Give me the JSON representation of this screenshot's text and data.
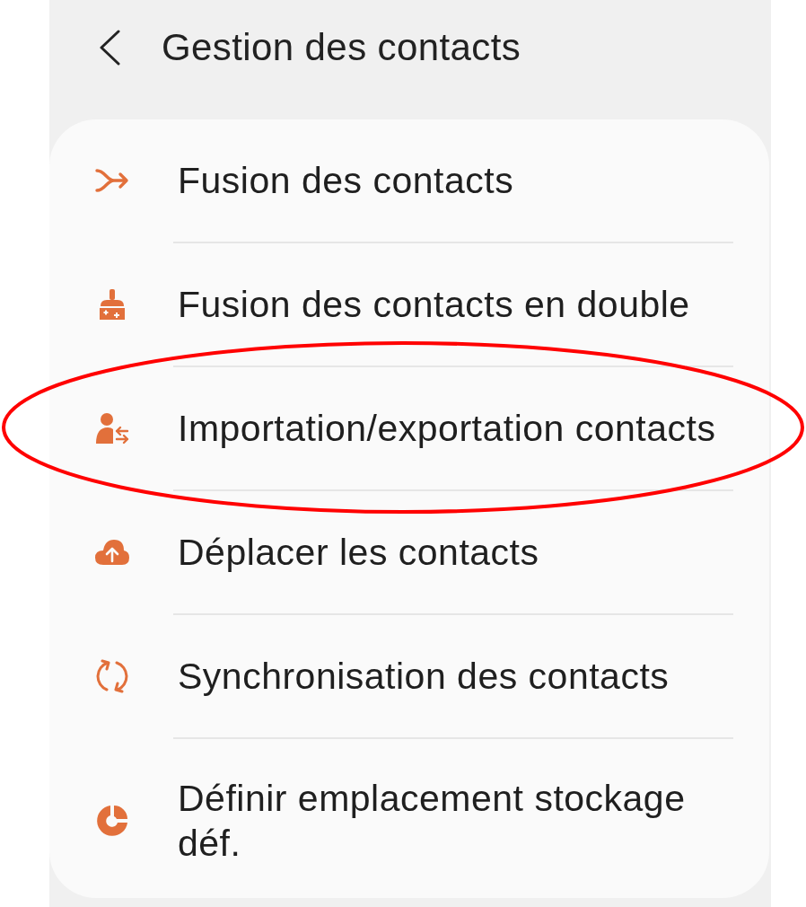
{
  "header": {
    "title": "Gestion des contacts"
  },
  "menu": {
    "items": [
      {
        "label": "Fusion des contacts",
        "circled": false
      },
      {
        "label": "Fusion des contacts en double",
        "circled": false
      },
      {
        "label": "Importation/exportation contacts",
        "circled": true
      },
      {
        "label": "Déplacer les contacts",
        "circled": false
      },
      {
        "label": "Synchronisation des contacts",
        "circled": false
      },
      {
        "label": "Définir emplacement stockage déf.",
        "circled": false
      }
    ]
  }
}
